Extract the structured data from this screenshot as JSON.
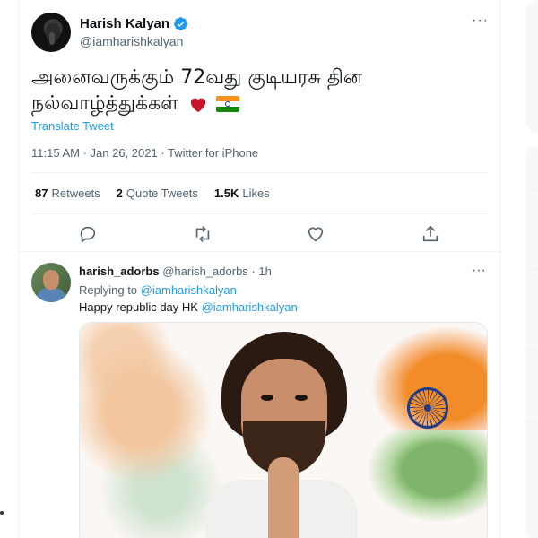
{
  "tweet": {
    "author_name": "Harish Kalyan",
    "author_handle": "@iamharishkalyan",
    "more_label": "···",
    "text_line1": "அனைவருக்கும் 72வது குடியரசு தின",
    "text_line2": "நல்வாழ்த்துக்கள்",
    "translate_label": "Translate Tweet",
    "meta": "11:15 AM · Jan 26, 2021 · Twitter for iPhone",
    "stats": {
      "retweets_count": "87",
      "retweets_label": "Retweets",
      "quotes_count": "2",
      "quotes_label": "Quote Tweets",
      "likes_count": "1.5K",
      "likes_label": "Likes"
    },
    "icons": [
      "verified-badge-icon",
      "heart-emoji-icon",
      "india-flag-icon",
      "reply-icon",
      "retweet-icon",
      "like-icon",
      "share-icon"
    ]
  },
  "reply": {
    "author_name": "harish_adorbs",
    "author_handle": "@harish_adorbs",
    "time": "· 1h",
    "more_label": "···",
    "replying_prefix": "Replying to",
    "replying_to": "@iamharishkalyan",
    "text": "Happy republic day HK",
    "mention": "@iamharishkalyan"
  },
  "colors": {
    "link": "#1d9bf0",
    "secondary_text": "#536471",
    "divider": "#eff3f4"
  }
}
